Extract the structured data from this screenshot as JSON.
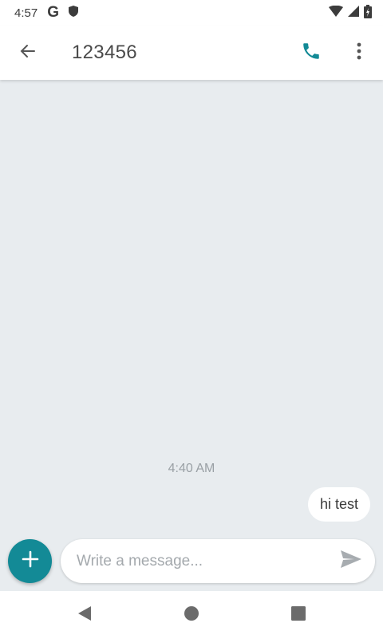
{
  "status_bar": {
    "time": "4:57",
    "left_icons": [
      "google-icon",
      "shield-icon"
    ],
    "right_icons": [
      "wifi-icon",
      "signal-icon",
      "battery-icon"
    ]
  },
  "app_bar": {
    "title": "123456",
    "icons": [
      "back-arrow-icon",
      "phone-icon",
      "more-vert-icon"
    ]
  },
  "conversation": {
    "timestamp": "4:40 AM",
    "messages": [
      {
        "text": "hi test",
        "direction": "outgoing"
      }
    ]
  },
  "composer": {
    "placeholder": "Write a message...",
    "value": ""
  },
  "colors": {
    "accent": "#138a96",
    "conversation_background": "#e8ecef",
    "bubble_background": "#ffffff"
  },
  "navigation": {
    "icons": [
      "back-triangle-icon",
      "home-circle-icon",
      "recents-square-icon"
    ]
  }
}
